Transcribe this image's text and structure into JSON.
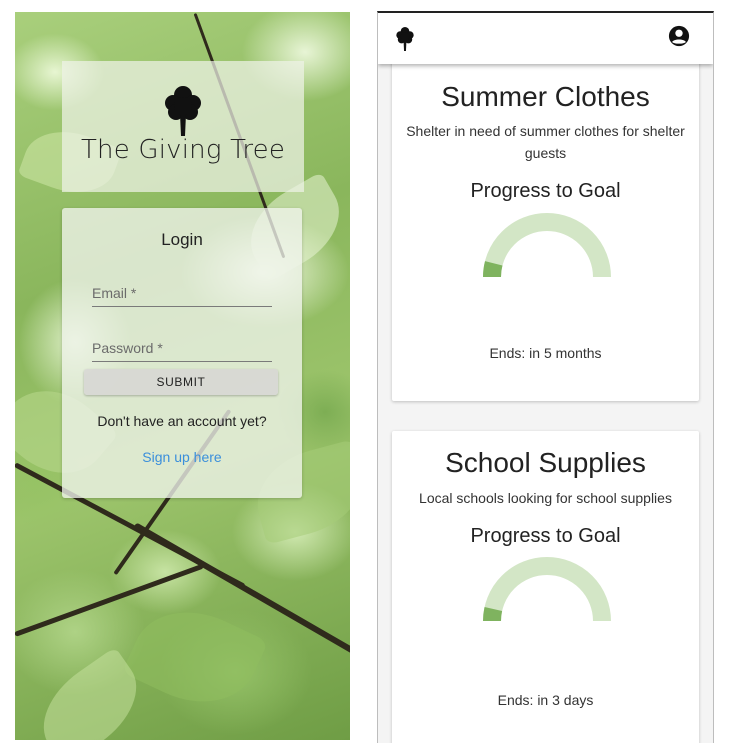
{
  "login_screen": {
    "app_name": "The Giving Tree",
    "login": {
      "title": "Login",
      "email_placeholder": "Email *",
      "password_placeholder": "Password *",
      "submit_label": "SUBMIT",
      "no_account_text": "Don't have an account yet?",
      "signup_link": "Sign up here"
    }
  },
  "campaigns_screen": {
    "appbar": {
      "logo_icon": "tree-icon",
      "account_icon": "account-circle-icon"
    },
    "campaigns": [
      {
        "title": "Summer Clothes",
        "description": "Shelter in need of summer clothes for shelter guests",
        "progress_label": "Progress to Goal",
        "progress": 0.08,
        "ends": "Ends: in 5 months"
      },
      {
        "title": "School Supplies",
        "description": "Local schools looking for school supplies",
        "progress_label": "Progress to Goal",
        "progress": 0.07,
        "ends": "Ends: in 3 days"
      }
    ],
    "colors": {
      "gauge_fill": "#7fb35f",
      "gauge_track": "#d3e6c6"
    }
  }
}
